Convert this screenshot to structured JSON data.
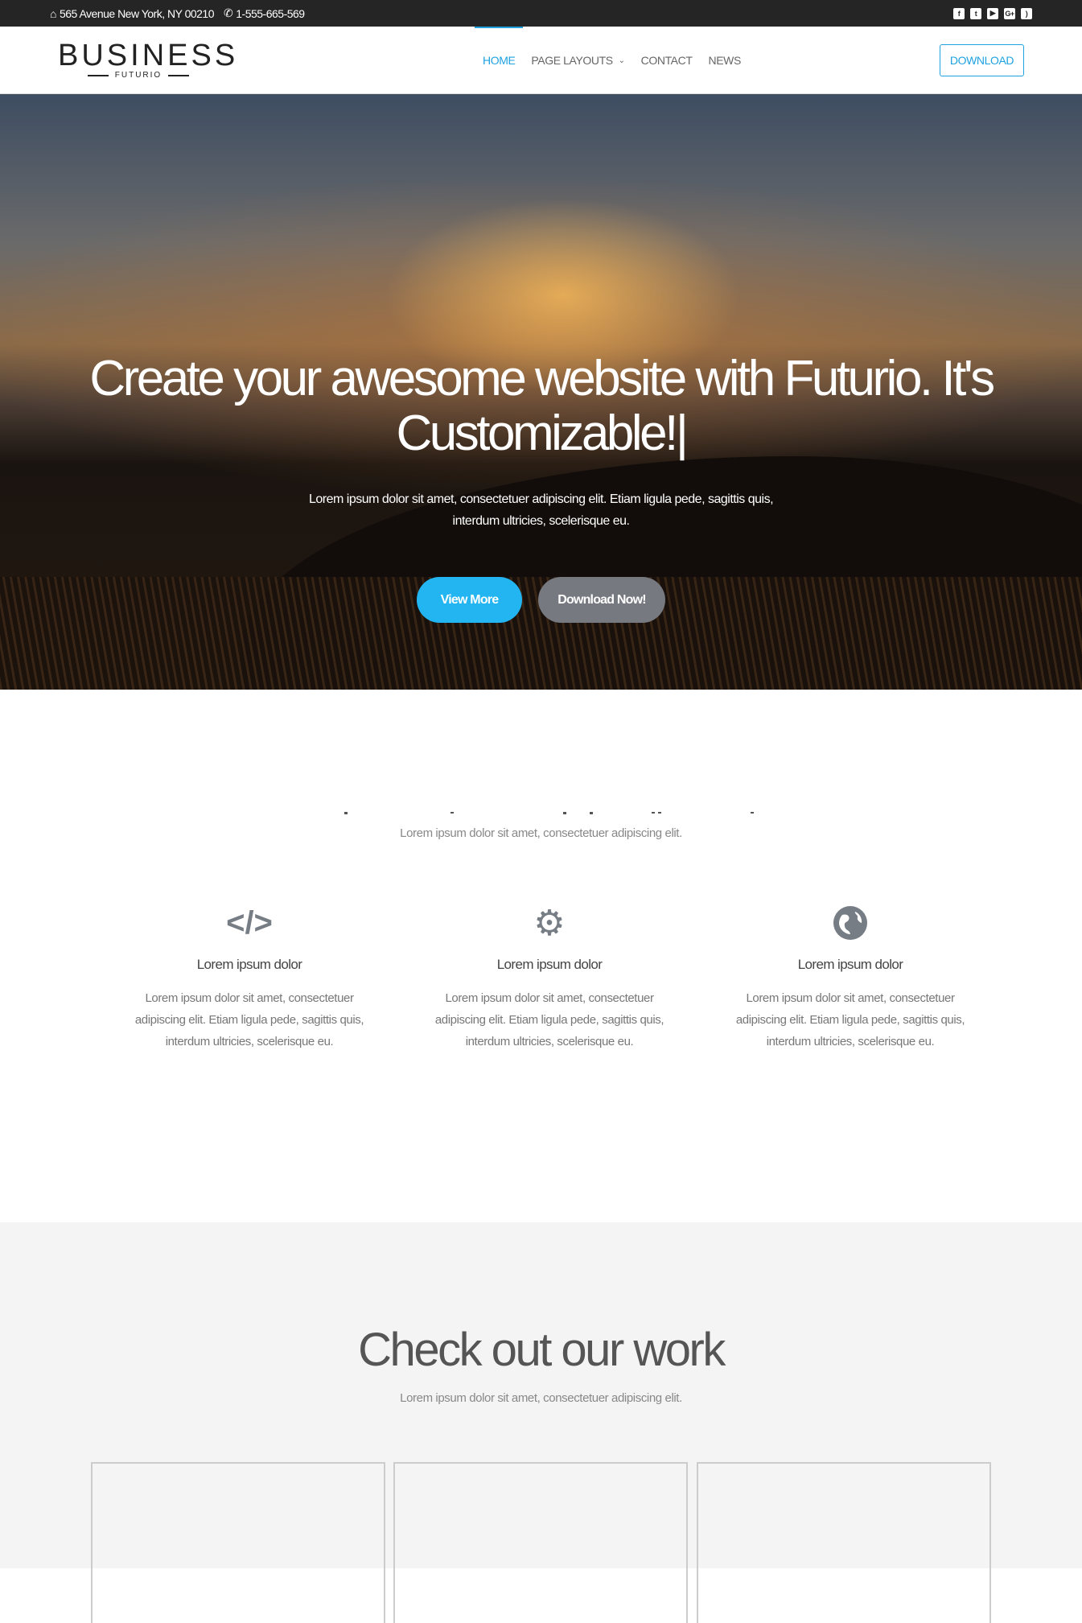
{
  "topbar": {
    "address": "565 Avenue New York, NY 00210",
    "phone": "1-555-665-569",
    "social": [
      "facebook-icon",
      "twitter-icon",
      "youtube-icon",
      "google-plus-icon",
      "rss-icon"
    ]
  },
  "nav": {
    "logo": "BUSINESS",
    "logo_sub": "FUTURIO",
    "items": [
      {
        "label": "HOME",
        "active": true
      },
      {
        "label": "PAGE LAYOUTS"
      },
      {
        "label": "CONTACT"
      },
      {
        "label": "NEWS"
      }
    ],
    "download": "DOWNLOAD",
    "accent": "#1fa2e0"
  },
  "hero": {
    "title": "Create your awesome website with Futurio. It's Customizable!|",
    "text_line1": "Lorem ipsum dolor sit amet, consectetuer adipiscing elit. Etiam ligula pede, sagittis quis,",
    "text_line2": "interdum ultricies, scelerisque eu.",
    "view_more": "View More",
    "download_now": "Download Now!"
  },
  "features": {
    "subtitle": "Lorem ipsum dolor sit amet, consectetuer adipiscing elit.",
    "items": [
      {
        "icon": "code-icon",
        "title": "Lorem ipsum dolor",
        "text": "Lorem ipsum dolor sit amet, consectetuer adipiscing elit. Etiam ligula pede, sagittis quis, interdum ultricies, scelerisque eu."
      },
      {
        "icon": "gears-icon",
        "title": "Lorem ipsum dolor",
        "text": "Lorem ipsum dolor sit amet, consectetuer adipiscing elit. Etiam ligula pede, sagittis quis, interdum ultricies, scelerisque eu."
      },
      {
        "icon": "globe-icon",
        "title": "Lorem ipsum dolor",
        "text": "Lorem ipsum dolor sit amet, consectetuer adipiscing elit. Etiam ligula pede, sagittis quis, interdum ultricies, scelerisque eu."
      }
    ]
  },
  "work": {
    "title": "Check out our work",
    "subtitle": "Lorem ipsum dolor sit amet, consectetuer adipiscing elit."
  }
}
